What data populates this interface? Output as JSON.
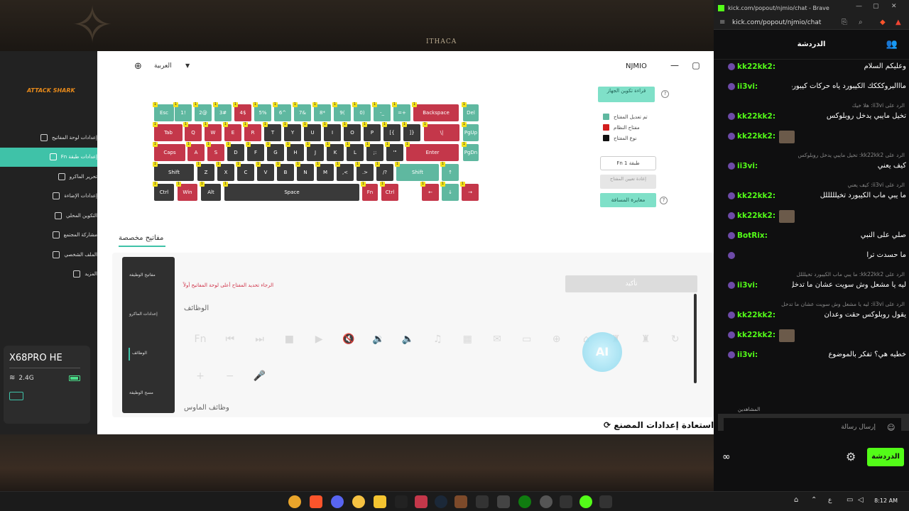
{
  "desktop": {
    "wallpaper_text": "ITHACA"
  },
  "app": {
    "brand": "ATTACK SHARK",
    "title": "NJMIO",
    "language": "العربية",
    "nav": [
      {
        "label": "إعدادات لوحة المفاتيح",
        "icon": "keyboard-icon"
      },
      {
        "label": "إعدادات طبقة Fn",
        "icon": "layer-icon"
      },
      {
        "label": "تحرير الماكرو",
        "icon": "macro-icon"
      },
      {
        "label": "إعدادات الإضاءة",
        "icon": "light-icon"
      },
      {
        "label": "التكوين المحلي",
        "icon": "folder-icon"
      },
      {
        "label": "مشاركة المجتمع",
        "icon": "share-icon"
      },
      {
        "label": "الملف الشخصي",
        "icon": "user-icon"
      },
      {
        "label": "المزيد",
        "icon": "more-icon"
      }
    ],
    "device": {
      "name": "X68PRO HE",
      "connection": "2.4G"
    },
    "controls": {
      "read_config": "قراءة تكوين الجهاز",
      "legend": [
        "تم تعديل المفتاح",
        "مفتاح النظام",
        "نوع المفتاح"
      ],
      "layer": "Fn 1 طبقة",
      "reset_layer": "إعادة تعيين المفتاح",
      "distance": "معايرة المسافة"
    },
    "keyboard": {
      "rows": [
        [
          "Esc",
          "1!",
          "2@",
          "3#",
          "4$",
          "5%",
          "6^",
          "7&",
          "8*",
          "9(",
          "0)",
          "-_",
          "=+",
          "Backspace",
          "Del"
        ],
        [
          "Tab",
          "Q",
          "W",
          "E",
          "R",
          "T",
          "Y",
          "U",
          "I",
          "O",
          "P",
          "[{",
          "]}",
          "\\|",
          "PgUp"
        ],
        [
          "Caps",
          "A",
          "S",
          "D",
          "F",
          "G",
          "H",
          "J",
          "K",
          "L",
          ";:",
          "'\"",
          "Enter",
          "PgDn"
        ],
        [
          "Shift",
          "Z",
          "X",
          "C",
          "V",
          "B",
          "N",
          "M",
          ",<",
          ".>",
          "/?",
          "Shift",
          "↑"
        ],
        [
          "Ctrl",
          "Win",
          "Alt",
          "Space",
          "Fn",
          "Ctrl",
          "←",
          "↓",
          "→"
        ]
      ],
      "badge": "1"
    },
    "custom": {
      "tab": "مفاتيح مخصصة",
      "subnav": [
        "مفاتيح الوظيفة",
        "إعدادات الماكرو",
        "الوظائف",
        "مسح الوظيفة"
      ],
      "warning": "الرجاء تحديد المفتاح أعلى لوحة المفاتيح أولاً",
      "confirm": "تأكيد",
      "functions_title": "الوظائف",
      "mouse_title": "وظائف الماوس",
      "function_icons": [
        "Fn",
        "⏮",
        "⏭",
        "■",
        "▶",
        "🔇",
        "🔉",
        "🔈",
        "♫",
        "▦",
        "✉",
        "▭",
        "⊕",
        "⌂",
        "♜",
        "♜",
        "↻",
        "+",
        "−",
        "🎤"
      ],
      "ai": "AI",
      "factory_reset": "استعادة إعدادات المصنع"
    }
  },
  "browser": {
    "window_title": "kick.com/popout/njmio/chat - Brave",
    "url": "kick.com/popout/njmio/chat",
    "chat_title": "الدردشة",
    "messages": [
      {
        "user": "kk22kk2:",
        "text": "وعليكم السلام",
        "color": "#53fc18"
      },
      {
        "user": "ii3vi:",
        "text": "مااالبروكككك الكيبورد ياه حركات كيبورد جد",
        "color": "#53fc18"
      },
      {
        "reply": "الرد على ii3vi: هلا خيك"
      },
      {
        "user": "kk22kk2:",
        "text": "تخيل مايبي يدخل روبلوكس",
        "color": "#53fc18"
      },
      {
        "user": "kk22kk2:",
        "text": "",
        "color": "#53fc18"
      },
      {
        "reply": "الرد على kk22kk2: تخيل مايبي يدخل روبلوكس"
      },
      {
        "user": "ii3vi:",
        "text": "كيف يعني",
        "color": "#53fc18"
      },
      {
        "reply": "الرد على ii3vi: كيف يعني"
      },
      {
        "user": "kk22kk2:",
        "text": "ما يبي ماب الكيبورد تخيلللللل",
        "color": "#53fc18"
      },
      {
        "user": "kk22kk2:",
        "text": "",
        "color": "#53fc18"
      },
      {
        "user": "BotRix:",
        "text": "صلي على النبي",
        "color": "#53fc18"
      },
      {
        "user": "",
        "text": "ما حسدت ترا",
        "color": "#53fc18"
      },
      {
        "reply": "الرد على kk22kk2: ما يبي ماب الكيبورد تخيلللل"
      },
      {
        "user": "ii3vi:",
        "text": "ليه يا مشعل وش سويت عشان ما تدخل",
        "color": "#53fc18"
      },
      {
        "reply": "الرد على ii3vi: ليه يا مشعل وش سويت عشان ما تدخل"
      },
      {
        "user": "kk22kk2:",
        "text": "يقول روبلوكس حقت وعدان",
        "color": "#53fc18"
      },
      {
        "user": "kk22kk2:",
        "text": "",
        "color": "#53fc18"
      },
      {
        "user": "ii3vi:",
        "text": "خطيه هي؟ تفكر بالموضوع",
        "color": "#53fc18"
      }
    ],
    "viewers": "المشاهدين",
    "input_placeholder": "إرسال رسالة",
    "send": "الدردشة"
  },
  "taskbar": {
    "time": "8:12 AM",
    "ime": "ع"
  }
}
